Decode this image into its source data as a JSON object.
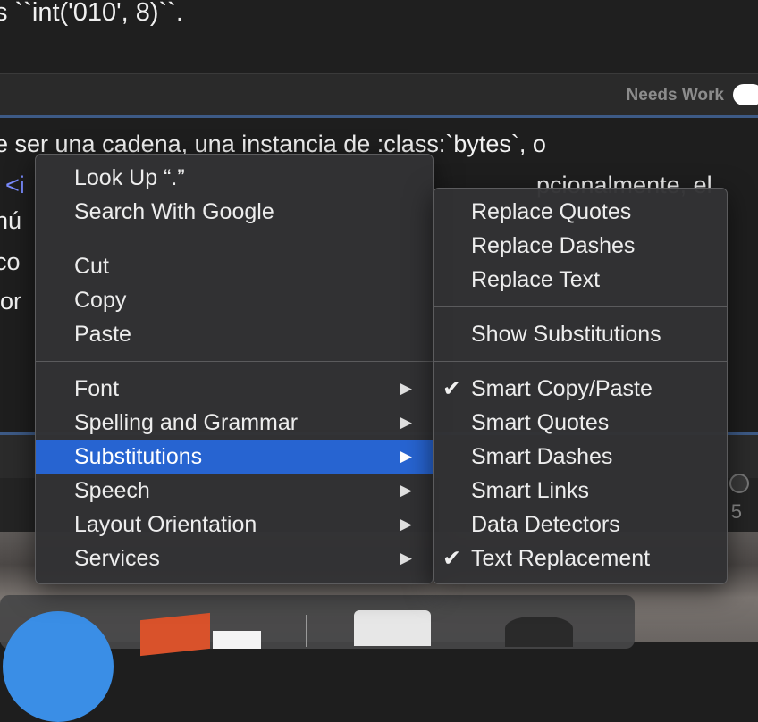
{
  "background": {
    "top_text": "s ``int('010', 8)``.",
    "status_label": "Needs Work",
    "editor_lines": [
      "e ser una cadena, una instancia de :class:`bytes`, o",
      "",
      " nú",
      " co",
      "lor"
    ],
    "editor_tag": "<i",
    "editor_partial": "pcionalmente, el",
    "page_num": "5"
  },
  "context_menu": {
    "items": [
      {
        "label": "Look Up “.”"
      },
      {
        "label": "Search With Google"
      },
      {
        "label": "Cut"
      },
      {
        "label": "Copy"
      },
      {
        "label": "Paste"
      },
      {
        "label": "Font"
      },
      {
        "label": "Spelling and Grammar"
      },
      {
        "label": "Substitutions"
      },
      {
        "label": "Speech"
      },
      {
        "label": "Layout Orientation"
      },
      {
        "label": "Services"
      }
    ],
    "arrow_glyph": "▶"
  },
  "substitutions_menu": {
    "items": [
      {
        "label": "Replace Quotes"
      },
      {
        "label": "Replace Dashes"
      },
      {
        "label": "Replace Text"
      },
      {
        "label": "Show Substitutions"
      },
      {
        "label": "Smart Copy/Paste",
        "checked": true
      },
      {
        "label": "Smart Quotes"
      },
      {
        "label": "Smart Dashes"
      },
      {
        "label": "Smart Links"
      },
      {
        "label": "Data Detectors"
      },
      {
        "label": "Text Replacement",
        "checked": true
      }
    ],
    "check_glyph": "✔"
  },
  "colors": {
    "selection": "#2764d1",
    "accent_border": "#3d5a86"
  }
}
